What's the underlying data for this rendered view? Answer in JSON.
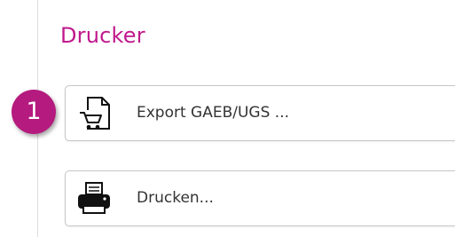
{
  "section": {
    "title": "Drucker"
  },
  "badge": {
    "number": "1"
  },
  "buttons": {
    "export_label": "Export GAEB/UGS ...",
    "print_label": "Drucken..."
  },
  "icons": {
    "export": "file-cart-icon",
    "print": "printer-icon"
  },
  "colors": {
    "accent": "#c0188c",
    "badge": "#b51a7f"
  }
}
